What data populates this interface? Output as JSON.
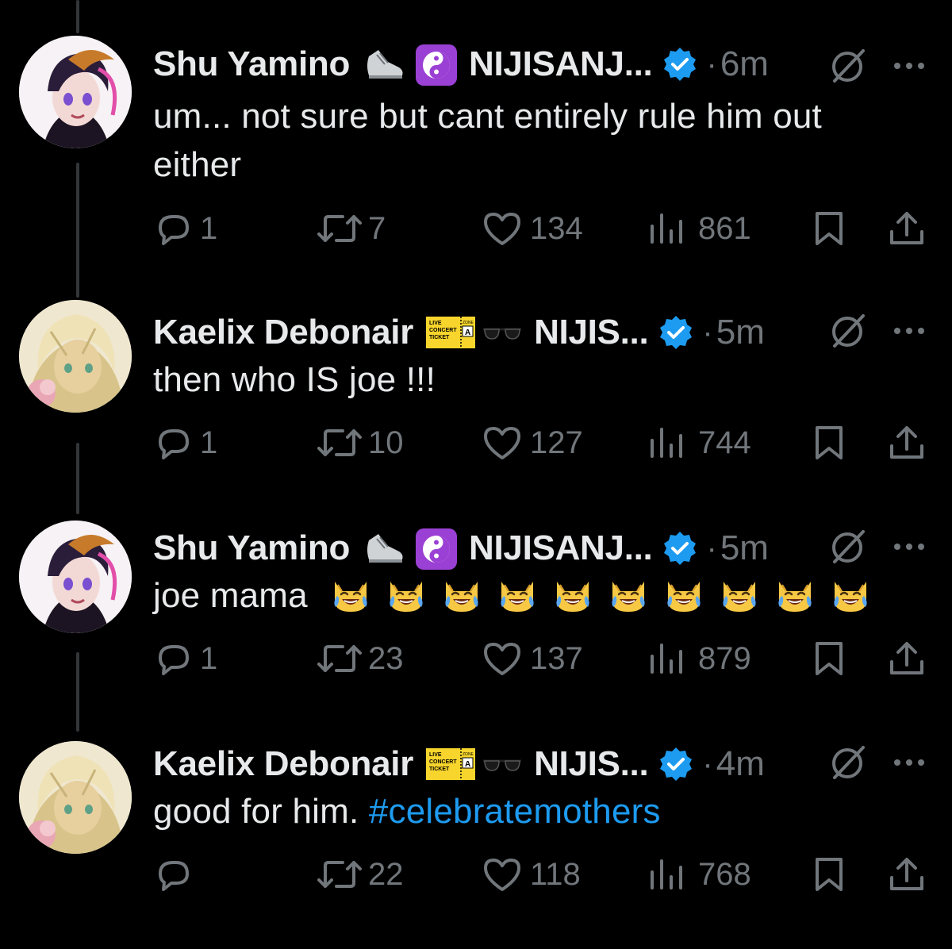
{
  "colors": {
    "background": "#000000",
    "text": "#e7e9ea",
    "muted": "#71767b",
    "verified": "#1d9bf0",
    "hashtag": "#1d9bf0",
    "thread_line": "#333639"
  },
  "tweets": [
    {
      "author": "Shu Yamino",
      "handle": "NIJISANJ...",
      "time": "6m",
      "text": "um... not sure but cant entirely rule him out either",
      "badge": "sneaker-yinyang",
      "replies": "1",
      "retweets": "7",
      "likes": "134",
      "views": "861"
    },
    {
      "author": "Kaelix Debonair",
      "handle": "NIJIS...",
      "time": "5m",
      "text": "then who IS joe !!!",
      "badge": "ticket-sunglasses",
      "replies": "1",
      "retweets": "10",
      "likes": "127",
      "views": "744"
    },
    {
      "author": "Shu Yamino",
      "handle": "NIJISANJ...",
      "time": "5m",
      "text": "joe mama",
      "emoji": "crying-laughing-cat",
      "emoji_count": 10,
      "badge": "sneaker-yinyang",
      "replies": "1",
      "retweets": "23",
      "likes": "137",
      "views": "879"
    },
    {
      "author": "Kaelix Debonair",
      "handle": "NIJIS...",
      "time": "4m",
      "text": "good for him.",
      "hashtag": "#celebratemothers",
      "badge": "ticket-sunglasses",
      "replies": "",
      "retweets": "22",
      "likes": "118",
      "views": "768"
    }
  ],
  "ticket_badge": {
    "lines": [
      "LIVE",
      "CONCERT",
      "TICKET"
    ],
    "zone": "ZONE",
    "zone_letter": "A"
  }
}
